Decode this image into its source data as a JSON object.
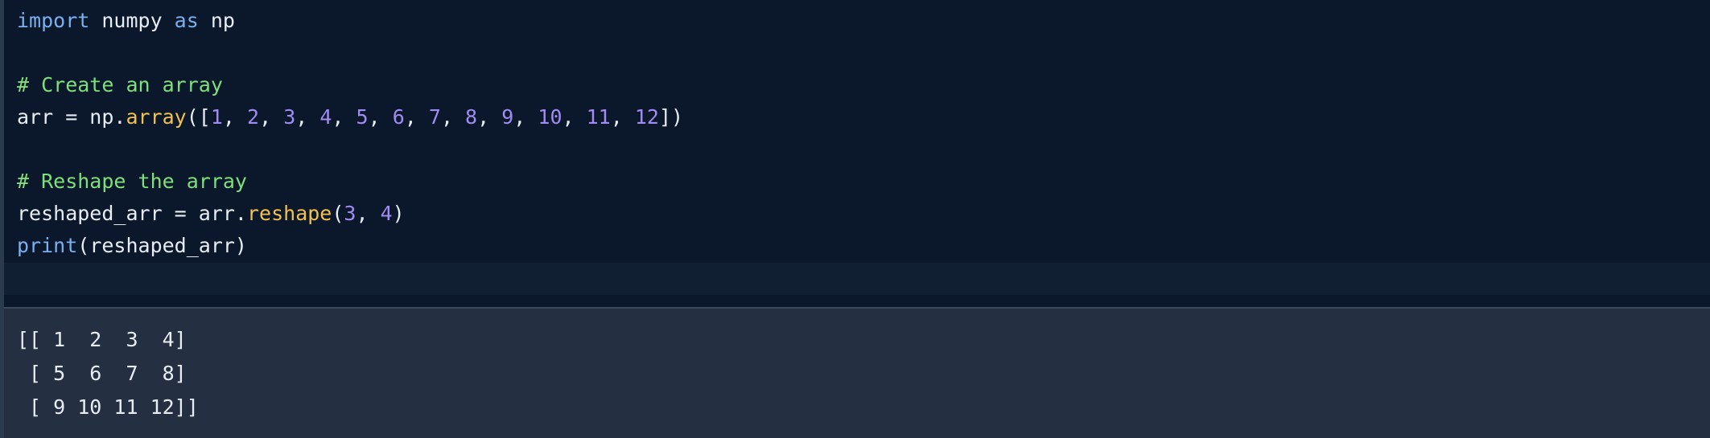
{
  "code": {
    "lines": [
      [
        {
          "t": "import",
          "k": "kw"
        },
        {
          "t": " numpy ",
          "k": "id"
        },
        {
          "t": "as",
          "k": "kw"
        },
        {
          "t": " np",
          "k": "id"
        }
      ],
      [],
      [
        {
          "t": "# Create an array",
          "k": "cmt"
        }
      ],
      [
        {
          "t": "arr = np.",
          "k": "id"
        },
        {
          "t": "array",
          "k": "fn"
        },
        {
          "t": "([",
          "k": "id"
        },
        {
          "t": "1",
          "k": "num"
        },
        {
          "t": ", ",
          "k": "id"
        },
        {
          "t": "2",
          "k": "num"
        },
        {
          "t": ", ",
          "k": "id"
        },
        {
          "t": "3",
          "k": "num"
        },
        {
          "t": ", ",
          "k": "id"
        },
        {
          "t": "4",
          "k": "num"
        },
        {
          "t": ", ",
          "k": "id"
        },
        {
          "t": "5",
          "k": "num"
        },
        {
          "t": ", ",
          "k": "id"
        },
        {
          "t": "6",
          "k": "num"
        },
        {
          "t": ", ",
          "k": "id"
        },
        {
          "t": "7",
          "k": "num"
        },
        {
          "t": ", ",
          "k": "id"
        },
        {
          "t": "8",
          "k": "num"
        },
        {
          "t": ", ",
          "k": "id"
        },
        {
          "t": "9",
          "k": "num"
        },
        {
          "t": ", ",
          "k": "id"
        },
        {
          "t": "10",
          "k": "num"
        },
        {
          "t": ", ",
          "k": "id"
        },
        {
          "t": "11",
          "k": "num"
        },
        {
          "t": ", ",
          "k": "id"
        },
        {
          "t": "12",
          "k": "num"
        },
        {
          "t": "])",
          "k": "id"
        }
      ],
      [],
      [
        {
          "t": "# Reshape the array",
          "k": "cmt"
        }
      ],
      [
        {
          "t": "reshaped_arr = arr.",
          "k": "id"
        },
        {
          "t": "reshape",
          "k": "fn"
        },
        {
          "t": "(",
          "k": "id"
        },
        {
          "t": "3",
          "k": "num"
        },
        {
          "t": ", ",
          "k": "id"
        },
        {
          "t": "4",
          "k": "num"
        },
        {
          "t": ")",
          "k": "id"
        }
      ],
      [
        {
          "t": "print",
          "k": "builtin"
        },
        {
          "t": "(reshaped_arr)",
          "k": "id"
        }
      ]
    ]
  },
  "output": {
    "lines": [
      "[[ 1  2  3  4]",
      " [ 5  6  7  8]",
      " [ 9 10 11 12]]"
    ]
  }
}
